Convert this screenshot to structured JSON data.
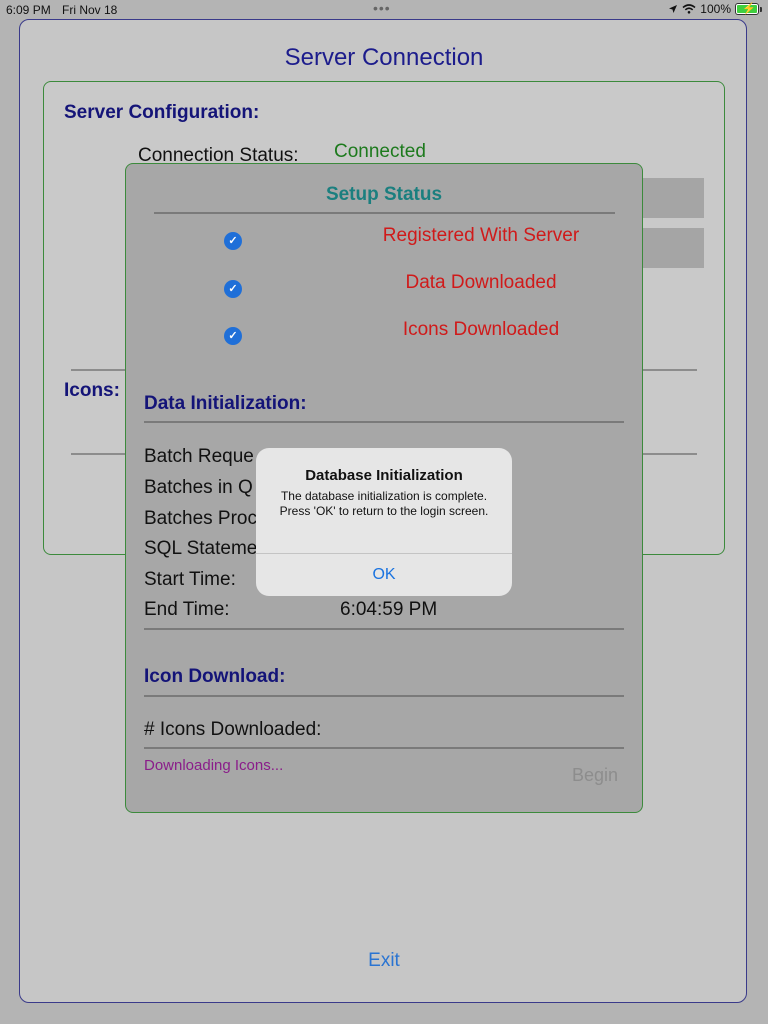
{
  "status_bar": {
    "time": "6:09 PM",
    "date": "Fri Nov 18",
    "multitask_dots": "•••",
    "battery_percent": "100%"
  },
  "sheet": {
    "title": "Server Connection",
    "exit_label": "Exit"
  },
  "server_config": {
    "title": "Server Configuration:",
    "connection_status_label": "Connection Status:",
    "connection_status_value": "Connected",
    "icons_label": "Icons:"
  },
  "setup_status": {
    "title": "Setup Status",
    "items": [
      {
        "label": "Registered With Server",
        "checked": true
      },
      {
        "label": "Data Downloaded",
        "checked": true
      },
      {
        "label": "Icons Downloaded",
        "checked": true
      }
    ]
  },
  "data_initialization": {
    "title": "Data Initialization:",
    "rows": [
      {
        "label": "Batch Reque"
      },
      {
        "label": "Batches in Q"
      },
      {
        "label": "Batches Proc"
      },
      {
        "label": "SQL Stateme"
      },
      {
        "label": "Start Time:"
      },
      {
        "label": "End Time:",
        "value": "6:04:59 PM"
      }
    ]
  },
  "icon_download": {
    "title": "Icon Download:",
    "icons_downloaded_label": "# Icons Downloaded:",
    "status": "Downloading Icons...",
    "begin_label": "Begin"
  },
  "alert": {
    "title": "Database Initialization",
    "message": "The database initialization is complete. Press 'OK' to return to the login screen.",
    "ok_label": "OK"
  },
  "colors": {
    "title_blue": "#1c1c8c",
    "connected_green": "#1d7a1d",
    "status_red": "#d01a1a",
    "setup_teal": "#1b7f7f",
    "link_blue": "#2a74d2",
    "downloading_purple": "#8a1d8a"
  }
}
